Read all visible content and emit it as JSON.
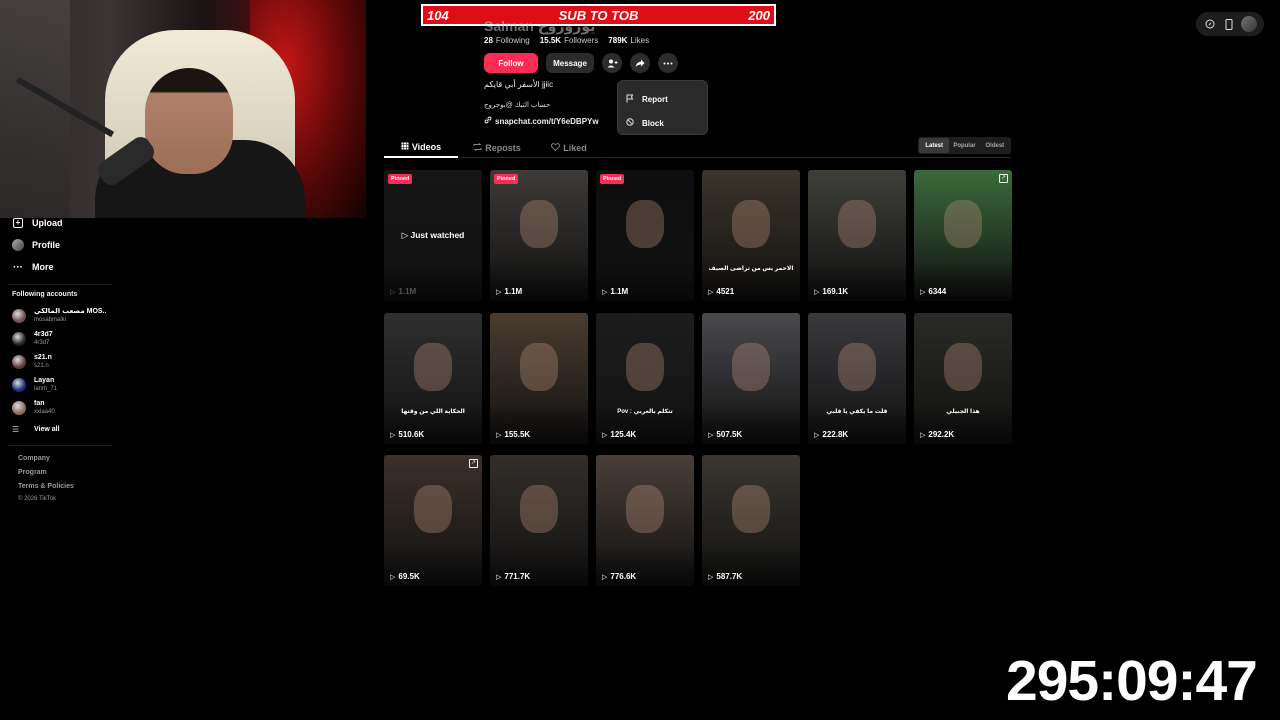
{
  "sub_banner": {
    "left": "104",
    "title": "SUB TO TOB",
    "right": "200"
  },
  "top_tools": {
    "icons": [
      "compass-icon",
      "phone-icon",
      "avatar-icon"
    ]
  },
  "profile": {
    "name": "Salman يوروروح",
    "stats": [
      {
        "value": "28",
        "label": "Following"
      },
      {
        "value": "15.5K",
        "label": "Followers"
      },
      {
        "value": "789K",
        "label": "Likes"
      }
    ],
    "follow_label": "Follow",
    "message_label": "Message",
    "bio_line1": "الأسفر أبي قايكم jjiic",
    "bio_line2": "حساب التيك @بوجروج",
    "link": "snapchat.com/t/Y6eDBPYw"
  },
  "dropdown": {
    "items": [
      {
        "icon": "flag-icon",
        "label": "Report"
      },
      {
        "icon": "block-icon",
        "label": "Block"
      }
    ]
  },
  "tabs": [
    {
      "label": "Videos"
    },
    {
      "label": "Reposts"
    },
    {
      "label": "Liked"
    }
  ],
  "sort": {
    "options": [
      "Latest",
      "Popular",
      "Oldest"
    ],
    "selected": "Latest"
  },
  "sidebar": {
    "items": [
      {
        "icon": "upload-icon",
        "label": "Upload"
      },
      {
        "icon": "profile-icon",
        "label": "Profile"
      },
      {
        "icon": "more-icon",
        "label": "More"
      }
    ],
    "following_label": "Following accounts",
    "accounts": [
      {
        "name": "مصعب المالكي MOS...",
        "handle": "mosabmalki",
        "color": "#6b4f4f"
      },
      {
        "name": "4r3d7",
        "handle": "4r3d7",
        "color": "#222222"
      },
      {
        "name": "s21.n",
        "handle": "s21.n",
        "color": "#5a3a3a"
      },
      {
        "name": "Layan",
        "handle": "lanm_71",
        "color": "#1c2c7c"
      },
      {
        "name": "fan",
        "handle": "xxlaa40",
        "color": "#8a6a5a"
      }
    ],
    "view_all": "View all",
    "footer": [
      "Company",
      "Program",
      "Terms & Policies"
    ],
    "copyright": "© 2026 TikTok"
  },
  "videos": [
    {
      "views": "1.1M",
      "pinned": true,
      "pinned_label": "Pinned",
      "watched": "Just watched",
      "dim": true,
      "bg": "#151515"
    },
    {
      "views": "1.1M",
      "pinned": true,
      "pinned_label": "Pinned",
      "bg": "#3d3a37"
    },
    {
      "views": "1.1M",
      "pinned": true,
      "pinned_label": "Pinned",
      "bg": "#0e0e0e"
    },
    {
      "views": "4521",
      "caption": "الاحمر بس من تراضى الصيف",
      "bg": "#3b342a"
    },
    {
      "views": "169.1K",
      "bg": "#3f3f3a"
    },
    {
      "views": "6344",
      "corner": true,
      "bg": "#3c6a3c"
    },
    {
      "views": "510.6K",
      "caption": "الحكاية اللي من وقتها",
      "bg": "#2f2f30"
    },
    {
      "views": "155.5K",
      "bg": "#4a3c30"
    },
    {
      "views": "125.4K",
      "caption": "Pov : تتكلم بالعربي",
      "bg": "#1d1d1d"
    },
    {
      "views": "507.5K",
      "bg": "#4a4a4e"
    },
    {
      "views": "222.8K",
      "caption": "قلت ما يكفي يا قلبي",
      "bg": "#3a3a3e"
    },
    {
      "views": "292.2K",
      "caption": "هذا الجبيلي",
      "bg": "#2a2a26"
    },
    {
      "views": "69.5K",
      "corner": true,
      "bg": "#3c302a"
    },
    {
      "views": "771.7K",
      "bg": "#332e2a"
    },
    {
      "views": "776.6K",
      "bg": "#4a3f38"
    },
    {
      "views": "587.7K",
      "bg": "#3a3630"
    }
  ],
  "timer": "295:09:47"
}
